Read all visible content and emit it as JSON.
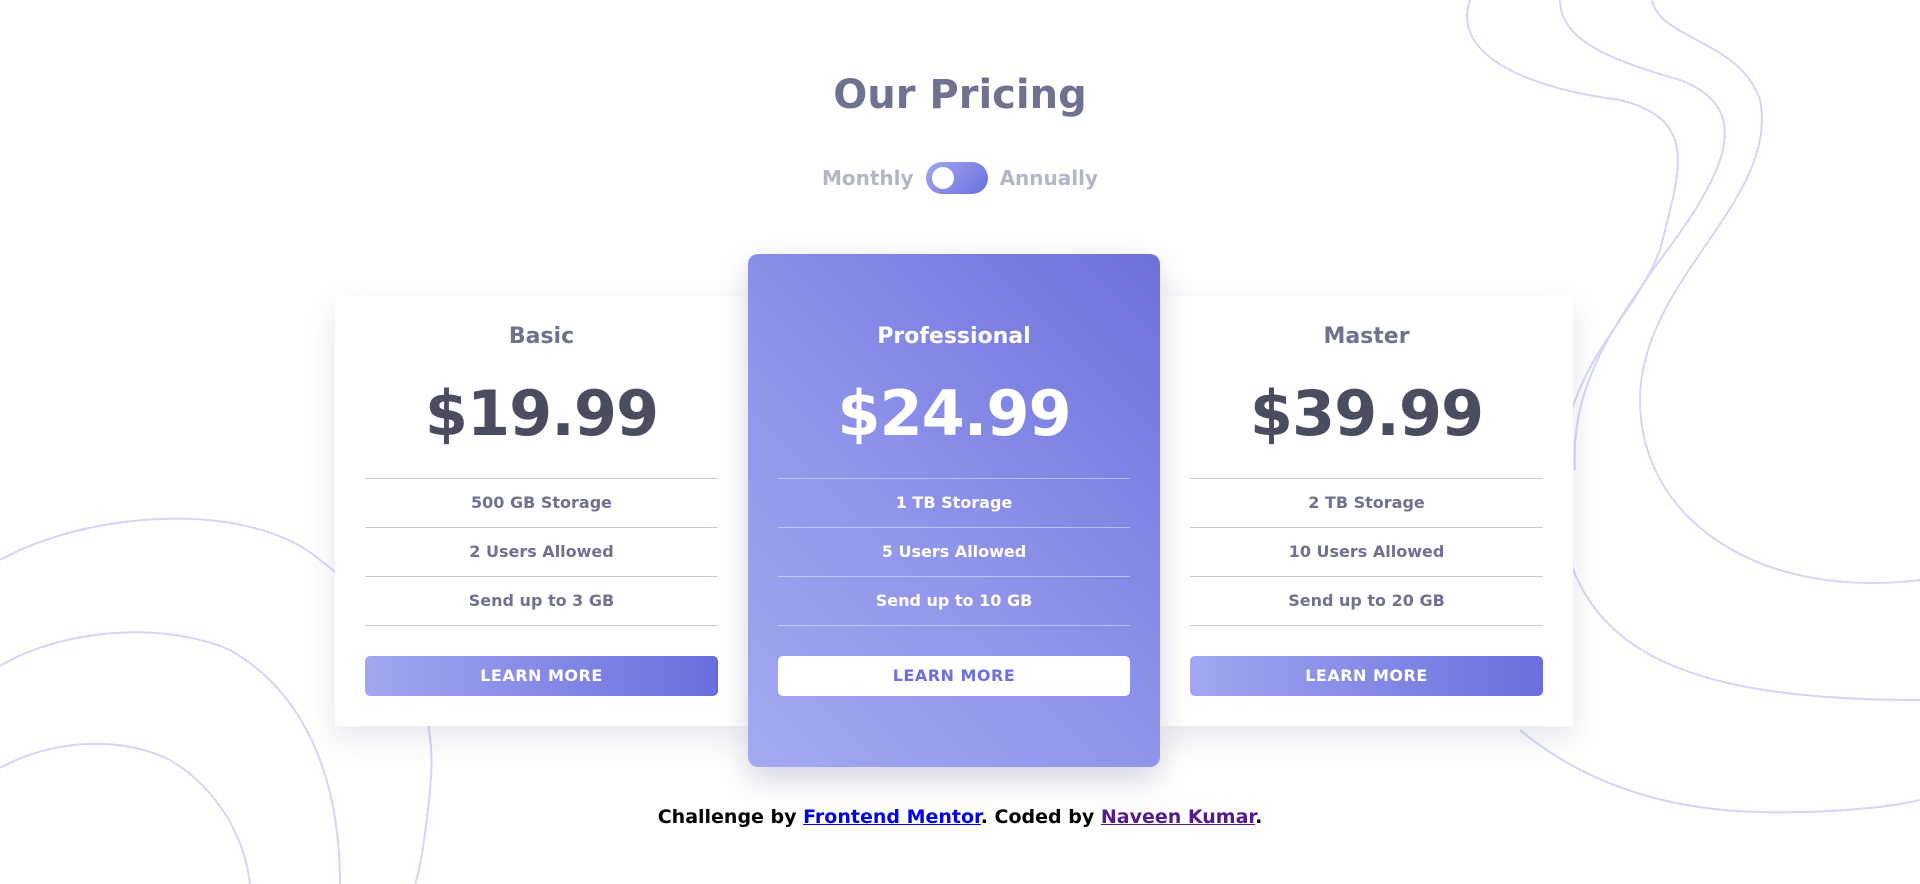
{
  "header": {
    "title": "Our Pricing"
  },
  "billing_toggle": {
    "left_label": "Monthly",
    "right_label": "Annually",
    "selected": "Monthly"
  },
  "plans": [
    {
      "name": "Basic",
      "price": "$19.99",
      "features": [
        "500 GB Storage",
        "2 Users Allowed",
        "Send up to 3 GB"
      ],
      "button_label": "LEARN MORE"
    },
    {
      "name": "Professional",
      "price": "$24.99",
      "features": [
        "1 TB Storage",
        "5 Users Allowed",
        "Send up to 10 GB"
      ],
      "button_label": "LEARN MORE"
    },
    {
      "name": "Master",
      "price": "$39.99",
      "features": [
        "2 TB Storage",
        "10 Users Allowed",
        "Send up to 20 GB"
      ],
      "button_label": "LEARN MORE"
    }
  ],
  "footer": {
    "prefix": "Challenge by ",
    "link1": "Frontend Mentor",
    "middle": ". Coded by ",
    "link2": "Naveen Kumar",
    "suffix": "."
  },
  "colors": {
    "accent_light": "#a2a7f0",
    "accent_dark": "#696edd",
    "heading": "#6e728e",
    "price": "#4a4d60",
    "background_curves": "#d3d6f5"
  }
}
